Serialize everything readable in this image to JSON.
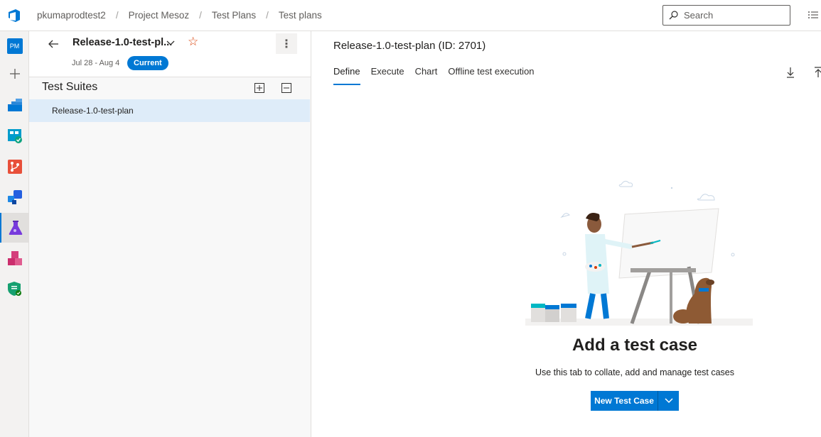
{
  "breadcrumb": [
    "pkumaprodtest2",
    "Project Mesoz",
    "Test Plans",
    "Test plans"
  ],
  "search": {
    "placeholder": "Search"
  },
  "rail": {
    "avatar_initials": "PM"
  },
  "plan": {
    "name": "Release-1.0-test-pl...",
    "dates": "Jul 28 - Aug 4",
    "badge": "Current",
    "more": "⋮"
  },
  "suites": {
    "title": "Test Suites",
    "items": [
      {
        "label": "Release-1.0-test-plan"
      }
    ]
  },
  "main": {
    "title": "Release-1.0-test-plan (ID: 2701)",
    "tabs": [
      {
        "label": "Define",
        "active": true
      },
      {
        "label": "Execute",
        "active": false
      },
      {
        "label": "Chart",
        "active": false
      },
      {
        "label": "Offline test execution",
        "active": false
      }
    ],
    "empty": {
      "title": "Add a test case",
      "description": "Use this tab to collate, add and manage test cases",
      "button": "New Test Case"
    }
  },
  "colors": {
    "accent": "#0078d4",
    "selection": "#deecf9",
    "star": "#d83b01"
  }
}
